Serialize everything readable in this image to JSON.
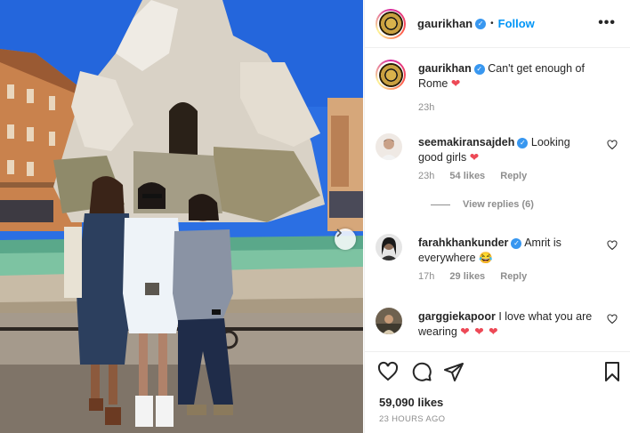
{
  "header": {
    "username": "gaurikhan",
    "separator": "•",
    "follow_label": "Follow",
    "more_label": "•••"
  },
  "caption": {
    "username": "gaurikhan",
    "text": "Can't get enough of Rome",
    "emoji": "❤",
    "time": "23h"
  },
  "comments": [
    {
      "username": "seemakiransajdeh",
      "text": "Looking good girls",
      "emoji": "❤",
      "time": "23h",
      "likes": "54 likes",
      "reply": "Reply",
      "view_replies": "View replies (6)"
    },
    {
      "username": "farahkhankunder",
      "text": "Amrit is everywhere",
      "emoji": "😂",
      "time": "17h",
      "likes": "29 likes",
      "reply": "Reply"
    },
    {
      "username": "garggiekapoor",
      "text": "I love what you are wearing",
      "emoji": "❤ ❤ ❤"
    }
  ],
  "footer": {
    "likes": "59,090 likes",
    "posted": "23 HOURS AGO"
  },
  "colors": {
    "accent": "#0095f6",
    "verified": "#3897f0",
    "heart": "#ed4956",
    "muted": "#8e8e8e"
  },
  "icons": [
    "verified-badge-icon",
    "heart-icon",
    "comment-icon",
    "share-icon",
    "bookmark-icon",
    "chevron-right-icon",
    "more-icon"
  ]
}
